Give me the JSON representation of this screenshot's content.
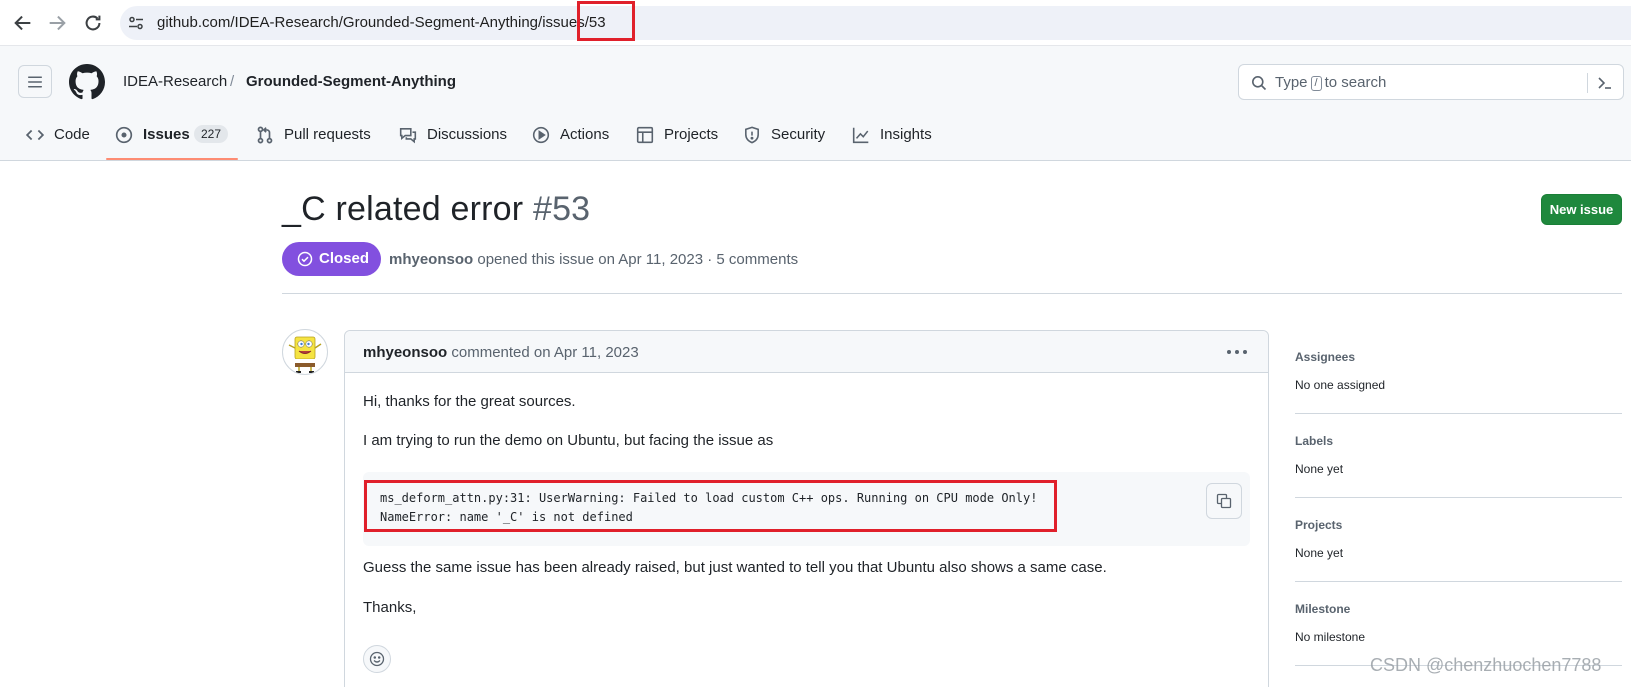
{
  "browser": {
    "url": "github.com/IDEA-Research/Grounded-Segment-Anything/issues/53"
  },
  "header": {
    "owner": "IDEA-Research",
    "separator": "/",
    "repo": "Grounded-Segment-Anything",
    "search": {
      "prefix": "Type",
      "key": "/",
      "suffix": "to search"
    }
  },
  "tabs": [
    {
      "label": "Code",
      "icon": "code-icon"
    },
    {
      "label": "Issues",
      "icon": "issue-opened-icon",
      "count": "227",
      "active": true
    },
    {
      "label": "Pull requests",
      "icon": "git-pull-request-icon"
    },
    {
      "label": "Discussions",
      "icon": "comment-discussion-icon"
    },
    {
      "label": "Actions",
      "icon": "play-icon"
    },
    {
      "label": "Projects",
      "icon": "table-icon"
    },
    {
      "label": "Security",
      "icon": "shield-icon"
    },
    {
      "label": "Insights",
      "icon": "graph-icon"
    }
  ],
  "issue": {
    "title": "_C related error",
    "number": "#53",
    "new_issue_label": "New issue",
    "state": "Closed",
    "author": "mhyeonsoo",
    "meta": "opened this issue on Apr 11, 2023 · 5 comments"
  },
  "comment": {
    "author": "mhyeonsoo",
    "action": "commented on Apr 11, 2023",
    "paragraphs": [
      "Hi, thanks for the great sources.",
      "I am trying to run the demo on Ubuntu, but facing the issue as",
      "Guess the same issue has been already raised, but just wanted to tell you that Ubuntu also shows a same case.",
      "Thanks,"
    ],
    "code": [
      "ms_deform_attn.py:31: UserWarning: Failed to load custom C++ ops. Running on CPU mode Only!",
      "NameError: name '_C' is not defined"
    ]
  },
  "sidebar": [
    {
      "heading": "Assignees",
      "value": "No one assigned"
    },
    {
      "heading": "Labels",
      "value": "None yet"
    },
    {
      "heading": "Projects",
      "value": "None yet"
    },
    {
      "heading": "Milestone",
      "value": "No milestone"
    }
  ],
  "watermark": "CSDN @chenzhuochen7788",
  "colors": {
    "closed_purple": "#8250df",
    "new_issue_green": "#1f883d",
    "annotation_red": "#e0202b",
    "tab_underline": "#fd8c73"
  }
}
